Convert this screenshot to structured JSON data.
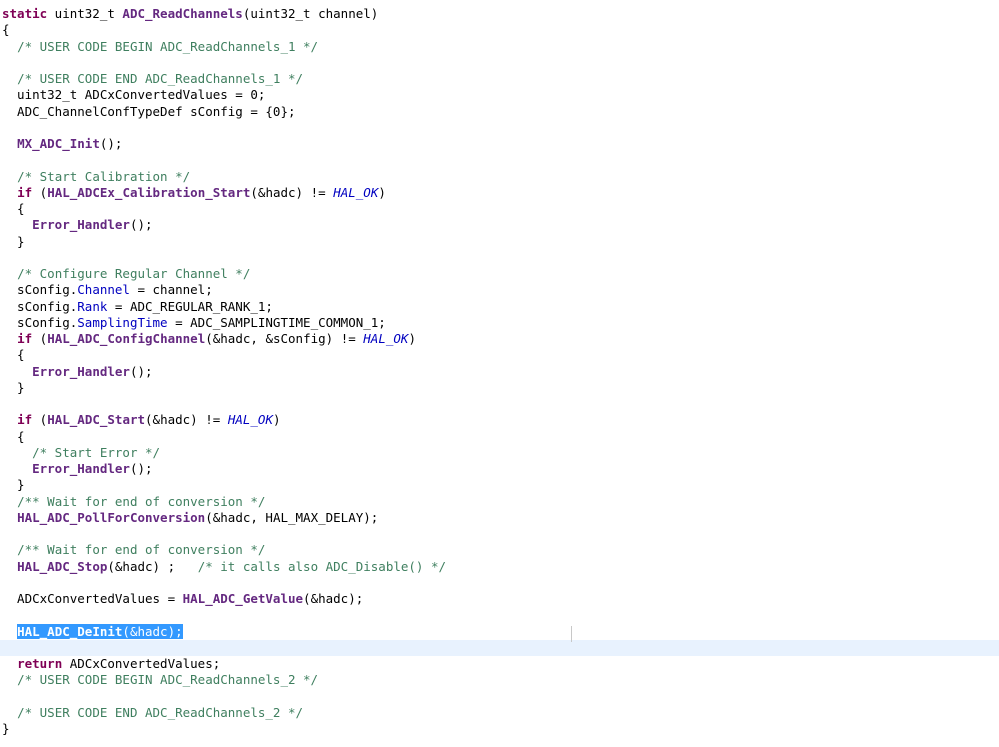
{
  "editor": {
    "current_line_index": 39,
    "lines": [
      [
        {
          "t": "static",
          "k": "keyword"
        },
        {
          "t": " uint32_t "
        },
        {
          "t": "ADC_ReadChannels",
          "k": "function"
        },
        {
          "t": "(uint32_t channel)"
        }
      ],
      [
        {
          "t": "{"
        }
      ],
      [
        {
          "t": "  "
        },
        {
          "t": "/* USER CODE BEGIN ADC_ReadChannels_1 */",
          "k": "comment"
        }
      ],
      [],
      [
        {
          "t": "  "
        },
        {
          "t": "/* USER CODE END ADC_ReadChannels_1 */",
          "k": "comment"
        }
      ],
      [
        {
          "t": "  uint32_t ADCxConvertedValues = 0;"
        }
      ],
      [
        {
          "t": "  ADC_ChannelConfTypeDef sConfig = {0};"
        }
      ],
      [],
      [
        {
          "t": "  "
        },
        {
          "t": "MX_ADC_Init",
          "k": "function"
        },
        {
          "t": "();"
        }
      ],
      [],
      [
        {
          "t": "  "
        },
        {
          "t": "/* Start Calibration */",
          "k": "comment"
        }
      ],
      [
        {
          "t": "  "
        },
        {
          "t": "if",
          "k": "keyword"
        },
        {
          "t": " ("
        },
        {
          "t": "HAL_ADCEx_Calibration_Start",
          "k": "function"
        },
        {
          "t": "(&hadc) != "
        },
        {
          "t": "HAL_OK",
          "k": "macro"
        },
        {
          "t": ")"
        }
      ],
      [
        {
          "t": "  {"
        }
      ],
      [
        {
          "t": "    "
        },
        {
          "t": "Error_Handler",
          "k": "function"
        },
        {
          "t": "();"
        }
      ],
      [
        {
          "t": "  }"
        }
      ],
      [],
      [
        {
          "t": "  "
        },
        {
          "t": "/* Configure Regular Channel */",
          "k": "comment"
        }
      ],
      [
        {
          "t": "  sConfig."
        },
        {
          "t": "Channel",
          "k": "field"
        },
        {
          "t": " = channel;"
        }
      ],
      [
        {
          "t": "  sConfig."
        },
        {
          "t": "Rank",
          "k": "field"
        },
        {
          "t": " = ADC_REGULAR_RANK_1;"
        }
      ],
      [
        {
          "t": "  sConfig."
        },
        {
          "t": "SamplingTime",
          "k": "field"
        },
        {
          "t": " = ADC_SAMPLINGTIME_COMMON_1;"
        }
      ],
      [
        {
          "t": "  "
        },
        {
          "t": "if",
          "k": "keyword"
        },
        {
          "t": " ("
        },
        {
          "t": "HAL_ADC_ConfigChannel",
          "k": "function"
        },
        {
          "t": "(&hadc, &sConfig) != "
        },
        {
          "t": "HAL_OK",
          "k": "macro"
        },
        {
          "t": ")"
        }
      ],
      [
        {
          "t": "  {"
        }
      ],
      [
        {
          "t": "    "
        },
        {
          "t": "Error_Handler",
          "k": "function"
        },
        {
          "t": "();"
        }
      ],
      [
        {
          "t": "  }"
        }
      ],
      [],
      [
        {
          "t": "  "
        },
        {
          "t": "if",
          "k": "keyword"
        },
        {
          "t": " ("
        },
        {
          "t": "HAL_ADC_Start",
          "k": "function"
        },
        {
          "t": "(&hadc) != "
        },
        {
          "t": "HAL_OK",
          "k": "macro"
        },
        {
          "t": ")"
        }
      ],
      [
        {
          "t": "  {"
        }
      ],
      [
        {
          "t": "    "
        },
        {
          "t": "/* Start Error */",
          "k": "comment"
        }
      ],
      [
        {
          "t": "    "
        },
        {
          "t": "Error_Handler",
          "k": "function"
        },
        {
          "t": "();"
        }
      ],
      [
        {
          "t": "  }"
        }
      ],
      [
        {
          "t": "  "
        },
        {
          "t": "/** Wait for end of conversion */",
          "k": "comment"
        }
      ],
      [
        {
          "t": "  "
        },
        {
          "t": "HAL_ADC_PollForConversion",
          "k": "function"
        },
        {
          "t": "(&hadc, HAL_MAX_DELAY);"
        }
      ],
      [],
      [
        {
          "t": "  "
        },
        {
          "t": "/** Wait for end of conversion */",
          "k": "comment"
        }
      ],
      [
        {
          "t": "  "
        },
        {
          "t": "HAL_ADC_Stop",
          "k": "function"
        },
        {
          "t": "(&hadc) ;   "
        },
        {
          "t": "/* it calls also ADC_Disable() */",
          "k": "comment"
        }
      ],
      [],
      [
        {
          "t": "  ADCxConvertedValues = "
        },
        {
          "t": "HAL_ADC_GetValue",
          "k": "function"
        },
        {
          "t": "(&hadc);"
        }
      ],
      [],
      [
        {
          "t": "  "
        },
        {
          "t": "HAL_ADC_DeInit",
          "k": "function",
          "sel": true
        },
        {
          "t": "(&hadc);",
          "sel": true
        }
      ],
      [],
      [
        {
          "t": "  "
        },
        {
          "t": "return",
          "k": "keyword"
        },
        {
          "t": " ADCxConvertedValues;"
        }
      ],
      [
        {
          "t": "  "
        },
        {
          "t": "/* USER CODE BEGIN ADC_ReadChannels_2 */",
          "k": "comment"
        }
      ],
      [],
      [
        {
          "t": "  "
        },
        {
          "t": "/* USER CODE END ADC_ReadChannels_2 */",
          "k": "comment"
        }
      ],
      [
        {
          "t": "}"
        }
      ]
    ]
  },
  "colors": {
    "keyword": "#7f0055",
    "comment": "#3f7f5f",
    "function": "#642880",
    "macro": "#0000c0",
    "field": "#0000c0",
    "current_line": "#e8f2fe",
    "selection": "#3399ff"
  }
}
